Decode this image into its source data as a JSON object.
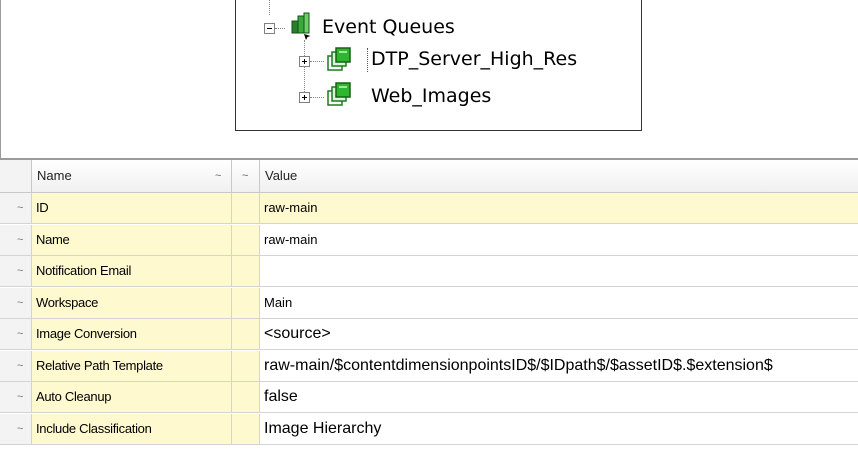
{
  "tree": {
    "root_label": "Event Queues",
    "children": [
      {
        "label": "DTP_Server_High_Res"
      },
      {
        "label": "Web_Images"
      }
    ]
  },
  "grid": {
    "headers": {
      "name": "Name",
      "sort1": "~",
      "sort2": "~",
      "value": "Value"
    },
    "rows": [
      {
        "name": "ID",
        "value": "raw-main",
        "marker": "~"
      },
      {
        "name": "Name",
        "value": "raw-main",
        "marker": "~"
      },
      {
        "name": "Notification Email",
        "value": "",
        "marker": "~"
      },
      {
        "name": "Workspace",
        "value": "Main",
        "marker": "~"
      },
      {
        "name": "Image Conversion",
        "value": "<source>",
        "marker": "~"
      },
      {
        "name": "Relative Path Template",
        "value": "raw-main/$contentdimensionpointsID$/$IDpath$/$assetID$.$extension$",
        "marker": "~"
      },
      {
        "name": "Auto Cleanup",
        "value": "false",
        "marker": "~"
      },
      {
        "name": "Include Classification",
        "value": "Image Hierarchy",
        "marker": "~"
      }
    ]
  },
  "colors": {
    "highlight": "#fff9cf",
    "queue_icon": "#19a019"
  }
}
